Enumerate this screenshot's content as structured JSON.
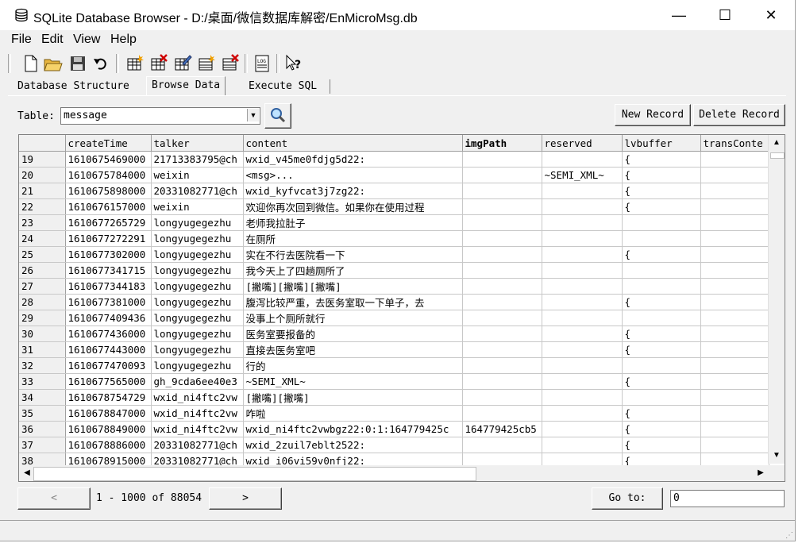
{
  "window": {
    "title": "SQLite Database Browser - D:/桌面/微信数据库解密/EnMicroMsg.db",
    "minimize": "—",
    "maximize": "☐",
    "close": "✕"
  },
  "menu": [
    "File",
    "Edit",
    "View",
    "Help"
  ],
  "toolbar": {
    "icons": [
      "new-database-icon",
      "open-database-icon",
      "save-icon",
      "undo-icon",
      "create-table-icon",
      "delete-table-icon",
      "modify-table-icon",
      "create-index-icon",
      "delete-index-icon",
      "log-icon",
      "whats-this-icon"
    ]
  },
  "tabs": [
    "Database Structure",
    "Browse Data",
    "Execute SQL"
  ],
  "active_tab": "Browse Data",
  "browse": {
    "table_label": "Table:",
    "table_value": "message",
    "new_record": "New Record",
    "delete_record": "Delete Record",
    "columns": [
      "createTime",
      "talker",
      "content",
      "imgPath",
      "reserved",
      "lvbuffer",
      "transConte"
    ],
    "rows": [
      {
        "n": "19",
        "createTime": "1610675469000",
        "talker": "21713383795@ch",
        "content": "wxid_v45me0fdjg5d22:",
        "imgPath": "",
        "reserved": "",
        "lvbuffer": "{"
      },
      {
        "n": "20",
        "createTime": "1610675784000",
        "talker": "weixin",
        "content": "<msg>...",
        "imgPath": "",
        "reserved": "~SEMI_XML~",
        "lvbuffer": "{"
      },
      {
        "n": "21",
        "createTime": "1610675898000",
        "talker": "20331082771@ch",
        "content": "wxid_kyfvcat3j7zg22:",
        "imgPath": "",
        "reserved": "",
        "lvbuffer": "{"
      },
      {
        "n": "22",
        "createTime": "1610676157000",
        "talker": "weixin",
        "content": "欢迎你再次回到微信。如果你在使用过程",
        "imgPath": "",
        "reserved": "",
        "lvbuffer": "{"
      },
      {
        "n": "23",
        "createTime": "1610677265729",
        "talker": "longyugegezhu",
        "content": "老师我拉肚子",
        "imgPath": "",
        "reserved": "",
        "lvbuffer": ""
      },
      {
        "n": "24",
        "createTime": "1610677272291",
        "talker": "longyugegezhu",
        "content": "在厕所",
        "imgPath": "",
        "reserved": "",
        "lvbuffer": ""
      },
      {
        "n": "25",
        "createTime": "1610677302000",
        "talker": "longyugegezhu",
        "content": "实在不行去医院看一下",
        "imgPath": "",
        "reserved": "",
        "lvbuffer": "{"
      },
      {
        "n": "26",
        "createTime": "1610677341715",
        "talker": "longyugegezhu",
        "content": "我今天上了四趟厕所了",
        "imgPath": "",
        "reserved": "",
        "lvbuffer": ""
      },
      {
        "n": "27",
        "createTime": "1610677344183",
        "talker": "longyugegezhu",
        "content": "[撇嘴][撇嘴][撇嘴]",
        "imgPath": "",
        "reserved": "",
        "lvbuffer": ""
      },
      {
        "n": "28",
        "createTime": "1610677381000",
        "talker": "longyugegezhu",
        "content": "腹泻比较严重，去医务室取一下单子，去",
        "imgPath": "",
        "reserved": "",
        "lvbuffer": "{"
      },
      {
        "n": "29",
        "createTime": "1610677409436",
        "talker": "longyugegezhu",
        "content": "没事上个厕所就行",
        "imgPath": "",
        "reserved": "",
        "lvbuffer": ""
      },
      {
        "n": "30",
        "createTime": "1610677436000",
        "talker": "longyugegezhu",
        "content": "医务室要报备的",
        "imgPath": "",
        "reserved": "",
        "lvbuffer": "{"
      },
      {
        "n": "31",
        "createTime": "1610677443000",
        "talker": "longyugegezhu",
        "content": "直接去医务室吧",
        "imgPath": "",
        "reserved": "",
        "lvbuffer": "{"
      },
      {
        "n": "32",
        "createTime": "1610677470093",
        "talker": "longyugegezhu",
        "content": "行的",
        "imgPath": "",
        "reserved": "",
        "lvbuffer": ""
      },
      {
        "n": "33",
        "createTime": "1610677565000",
        "talker": "gh_9cda6ee40e3",
        "content": "~SEMI_XML~",
        "imgPath": "",
        "reserved": "",
        "lvbuffer": "{"
      },
      {
        "n": "34",
        "createTime": "1610678754729",
        "talker": "wxid_ni4ftc2vw",
        "content": "[撇嘴][撇嘴]",
        "imgPath": "",
        "reserved": "",
        "lvbuffer": ""
      },
      {
        "n": "35",
        "createTime": "1610678847000",
        "talker": "wxid_ni4ftc2vw",
        "content": "咋啦",
        "imgPath": "",
        "reserved": "",
        "lvbuffer": "{"
      },
      {
        "n": "36",
        "createTime": "1610678849000",
        "talker": "wxid_ni4ftc2vw",
        "content": "wxid_ni4ftc2vwbgz22:0:1:164779425c",
        "imgPath": "164779425cb5",
        "reserved": "",
        "lvbuffer": "{"
      },
      {
        "n": "37",
        "createTime": "1610678886000",
        "talker": "20331082771@ch",
        "content": "wxid_2zuil7eblt2522:",
        "imgPath": "",
        "reserved": "",
        "lvbuffer": "{"
      },
      {
        "n": "38",
        "createTime": "1610678915000",
        "talker": "20331082771@ch",
        "content": "wxid_i06vi59v0nfj22:",
        "imgPath": "",
        "reserved": "",
        "lvbuffer": "{"
      }
    ],
    "prev_label": "<",
    "next_label": ">",
    "range_text": "1 - 1000 of 88054",
    "goto_label": "Go to:",
    "goto_value": "0"
  }
}
